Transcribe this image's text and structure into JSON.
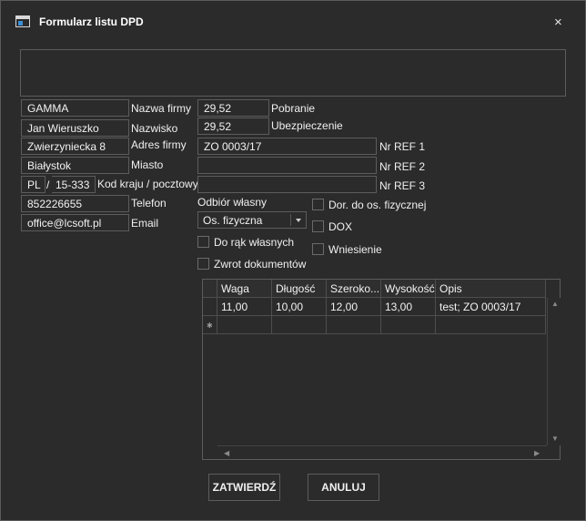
{
  "window": {
    "title": "Formularz listu DPD",
    "close_glyph": "×"
  },
  "sender": {
    "company": "GAMMA",
    "name": "Jan Wieruszko",
    "address": "Zwierzyniecka 8",
    "city": "Białystok",
    "country": "PL",
    "slash": "/",
    "postal": "15-333",
    "phone": "852226655",
    "email": "office@lcsoft.pl"
  },
  "labels": {
    "company": "Nazwa firmy",
    "name": "Nazwisko",
    "address": "Adres firmy",
    "city": "Miasto",
    "country_postal": "Kod kraju / pocztowy",
    "phone": "Telefon",
    "email": "Email",
    "cod": "Pobranie",
    "insurance": "Ubezpieczenie",
    "ref1": "Nr REF 1",
    "ref2": "Nr REF 2",
    "ref3": "Nr REF 3",
    "pickup": "Odbiór własny",
    "to_person": "Dor. do os. fizycznej",
    "dox": "DOX",
    "carry_in": "Wniesienie",
    "own_hands": "Do rąk własnych",
    "doc_return": "Zwrot dokumentów"
  },
  "shipment": {
    "cod": "29,52",
    "insurance": "29,52",
    "ref1": "ZO 0003/17",
    "ref2": "",
    "ref3": "",
    "pickup_option": "Os. fizyczna"
  },
  "checks": {
    "to_person": false,
    "dox": false,
    "carry_in": false,
    "own_hands": false,
    "doc_return": false
  },
  "grid": {
    "columns": [
      "Waga",
      "Długość",
      "Szeroko...",
      "Wysokość",
      "Opis"
    ],
    "rows": [
      [
        "11,00",
        "10,00",
        "12,00",
        "13,00",
        "test; ZO 0003/17"
      ]
    ],
    "new_row_marker": "✱"
  },
  "buttons": {
    "confirm": "ZATWIERDŹ",
    "cancel": "ANULUJ"
  }
}
